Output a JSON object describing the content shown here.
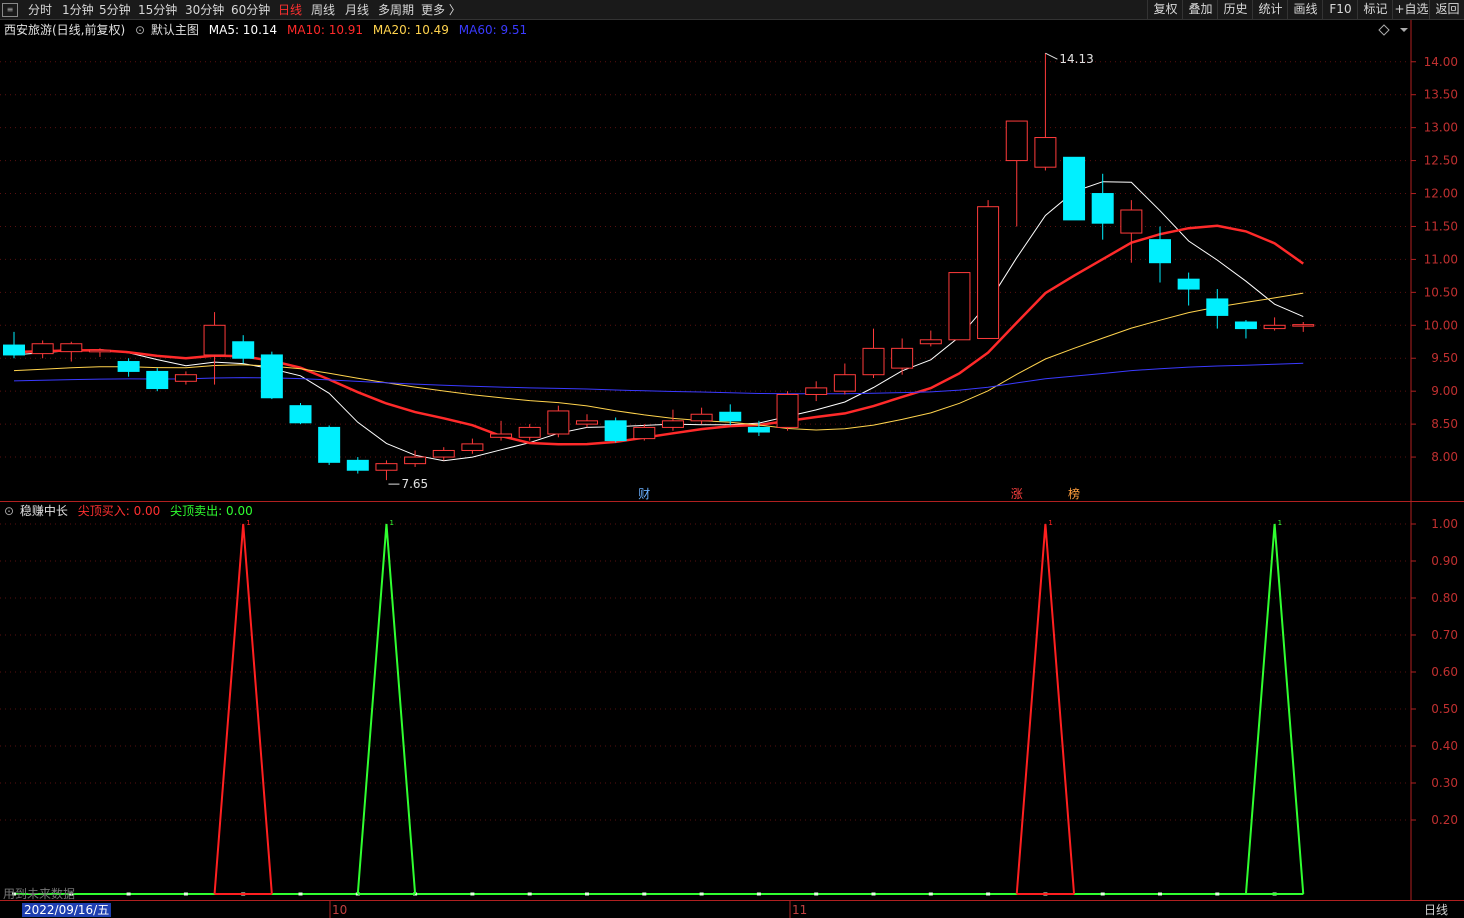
{
  "toolbar": {
    "periods": [
      "分时",
      "1分钟",
      "5分钟",
      "15分钟",
      "30分钟",
      "60分钟",
      "日线",
      "周线",
      "月线",
      "多周期",
      "更多 〉"
    ],
    "active": "日线",
    "right_buttons": [
      "复权",
      "叠加",
      "历史",
      "统计",
      "画线",
      "F10",
      "标记",
      "+自选",
      "返回"
    ]
  },
  "main": {
    "stock": "西安旅游(日线,前复权)",
    "template": "默认主图",
    "ma": [
      {
        "label": "MA5: 10.14",
        "color": "#ffffff"
      },
      {
        "label": "MA10: 10.91",
        "color": "#ff2a2a"
      },
      {
        "label": "MA20: 10.49",
        "color": "#ffd34d"
      },
      {
        "label": "MA60: 9.51",
        "color": "#3a3aff"
      }
    ],
    "high_label": "14.13",
    "low_label": "7.65",
    "events": [
      {
        "text": "财",
        "color": "#6ab0ff",
        "idx": 22
      },
      {
        "text": "涨",
        "color": "#ff4040",
        "idx": 35
      },
      {
        "text": "榜",
        "color": "#ff9e3d",
        "idx": 37
      }
    ]
  },
  "indicator": {
    "name": "稳赚中长",
    "buy": {
      "label": "尖顶买入: 0.00",
      "color": "#ff3030"
    },
    "sell": {
      "label": "尖顶卖出: 0.00",
      "color": "#30ff30"
    },
    "flag_top": "1",
    "ticks": [
      "1.00",
      "0.90",
      "0.80",
      "0.70",
      "0.60",
      "0.50",
      "0.40",
      "0.30",
      "0.20"
    ],
    "warning": "用到未来数据"
  },
  "footer": {
    "date": "2022/09/16/五",
    "months": [
      "10",
      "11"
    ],
    "period": "日线"
  },
  "colors": {
    "up": "#ff3b3b",
    "down": "#00f0ff",
    "grid": "#5a1010",
    "axis": "#b02020"
  },
  "chart_data": {
    "type": "candlestick",
    "y_range": [
      7.5,
      14.3
    ],
    "ticks": [
      8.0,
      8.5,
      9.0,
      9.5,
      10.0,
      10.5,
      11.0,
      11.5,
      12.0,
      12.5,
      13.0,
      13.5,
      14.0
    ],
    "candles": [
      [
        9.7,
        9.55,
        9.9,
        9.5
      ],
      [
        9.57,
        9.72,
        9.77,
        9.5
      ],
      [
        9.6,
        9.72,
        9.75,
        9.45
      ],
      [
        9.6,
        9.62,
        9.65,
        9.52
      ],
      [
        9.45,
        9.3,
        9.5,
        9.22
      ],
      [
        9.3,
        9.04,
        9.35,
        9.0
      ],
      [
        9.15,
        9.25,
        9.3,
        9.1
      ],
      [
        9.55,
        10.0,
        10.2,
        9.1
      ],
      [
        9.75,
        9.5,
        9.85,
        9.42
      ],
      [
        9.55,
        8.9,
        9.6,
        8.88
      ],
      [
        8.78,
        8.52,
        8.82,
        8.5
      ],
      [
        8.45,
        7.92,
        8.48,
        7.88
      ],
      [
        7.95,
        7.8,
        8.0,
        7.75
      ],
      [
        7.8,
        7.9,
        7.95,
        7.65
      ],
      [
        7.9,
        8.0,
        8.1,
        7.85
      ],
      [
        8.0,
        8.1,
        8.15,
        7.95
      ],
      [
        8.1,
        8.2,
        8.28,
        8.05
      ],
      [
        8.3,
        8.35,
        8.55,
        8.25
      ],
      [
        8.3,
        8.45,
        8.5,
        8.25
      ],
      [
        8.35,
        8.7,
        8.78,
        8.3
      ],
      [
        8.5,
        8.55,
        8.65,
        8.45
      ],
      [
        8.55,
        8.25,
        8.6,
        8.22
      ],
      [
        8.28,
        8.45,
        8.5,
        8.25
      ],
      [
        8.45,
        8.55,
        8.72,
        8.4
      ],
      [
        8.55,
        8.65,
        8.75,
        8.5
      ],
      [
        8.68,
        8.55,
        8.8,
        8.48
      ],
      [
        8.45,
        8.38,
        8.55,
        8.32
      ],
      [
        8.45,
        8.95,
        9.0,
        8.4
      ],
      [
        8.95,
        9.05,
        9.15,
        8.85
      ],
      [
        9.0,
        9.25,
        9.42,
        8.95
      ],
      [
        9.25,
        9.65,
        9.95,
        9.2
      ],
      [
        9.35,
        9.65,
        9.8,
        9.25
      ],
      [
        9.72,
        9.78,
        9.92,
        9.68
      ],
      [
        9.78,
        10.8,
        10.8,
        9.78
      ],
      [
        9.8,
        11.8,
        11.9,
        9.8
      ],
      [
        12.5,
        13.1,
        13.1,
        11.5
      ],
      [
        12.4,
        12.85,
        14.13,
        12.35
      ],
      [
        12.55,
        11.6,
        12.55,
        11.6
      ],
      [
        12.0,
        11.55,
        12.3,
        11.3
      ],
      [
        11.4,
        11.75,
        11.9,
        10.95
      ],
      [
        11.3,
        10.95,
        11.5,
        10.65
      ],
      [
        10.7,
        10.55,
        10.8,
        10.3
      ],
      [
        10.4,
        10.15,
        10.55,
        9.95
      ],
      [
        10.05,
        9.95,
        10.08,
        9.8
      ],
      [
        9.95,
        10.0,
        10.12,
        9.92
      ],
      [
        10.0,
        10.01,
        10.05,
        9.9
      ]
    ],
    "buy_spikes": [
      13,
      44
    ],
    "sell_spikes": [
      8,
      36
    ],
    "ind_ylim": [
      0,
      1
    ]
  }
}
